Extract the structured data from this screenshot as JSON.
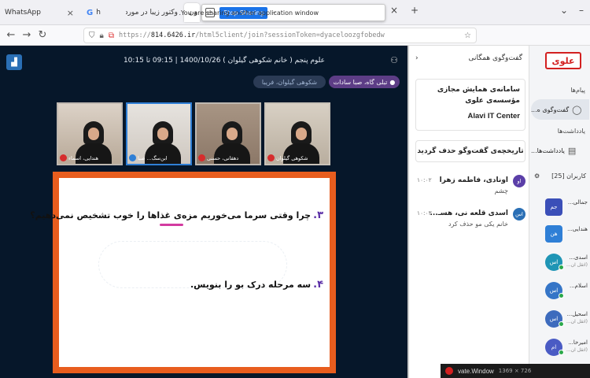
{
  "browser": {
    "tabs": [
      {
        "label": "WhatsApp",
        "active": false
      },
      {
        "label": "h",
        "active": false
      },
      {
        "label": "وکتور زیبا در مورد ایرانگردی",
        "active": false
      },
      {
        "label": "ون",
        "active": true
      }
    ],
    "google_letter": "G",
    "share_bar": {
      "message": "You are sharing another application window.",
      "stop_label": "Stop Sharing",
      "minimize_label": "–"
    },
    "url": {
      "prefix": "https://",
      "host": "814.6426.ir",
      "path": "/html5client/join?sessionToken=dyaceloozgfobedw"
    },
    "new_tab": "+"
  },
  "conference": {
    "title": "علوم پنجم ( خانم شکوهی گیلوان ) 1400/10/26 | 09:15 تا 10:15",
    "talking": "تبلی گاه، صبا سادات",
    "talking2": "شکوهی گیلوان، فریبا",
    "videos": [
      {
        "name": "شکوهی گیلوان",
        "active": false
      },
      {
        "name": "دهقانی، حسنی",
        "active": false
      },
      {
        "name": "ابن‌سگ... صبا",
        "active": true
      },
      {
        "name": "هندایی، اسماء",
        "active": false
      }
    ],
    "slide": {
      "q1_num": "۳.",
      "q1_text": "چرا وقتی سرما می‌خوریم مزه‌ی غذاها را خوب تشخیص نمی‌دهیم؟",
      "q2_num": "۴.",
      "q2_text": "سه مرحله درک بو را بنویس."
    }
  },
  "chat": {
    "header": "گفت‌وگوی همگانی",
    "collapse_icon": "‹",
    "welcome_title": "سامانه‌ی همایش مجازی مؤسسه‌ی علوی",
    "welcome_en": "Alavi IT Center",
    "history_btn": "تاریخچه‌ی گفت‌وگو حذف گردید",
    "messages": [
      {
        "avatar": "او",
        "name": "اونادی، فاطمه زهرا",
        "time": "۱۰:۰۲",
        "text": "چشم",
        "color": "#5b3fa8"
      },
      {
        "avatar": "اس",
        "name": "اسدی قلعه نی، هسـ...",
        "time": "۱۰:۰۳",
        "text": "خانم یکی مو حذف کرد",
        "color": "#2a6fb5"
      }
    ]
  },
  "sidebar": {
    "logo": "علوی",
    "messages_section": "پیام‌ها",
    "public_chat": "گفت‌وگوی ه...",
    "notes_section": "یادداشت‌ها",
    "shared_notes": "یادداشت‌ها...",
    "users_label": "کاربران [25]",
    "users": [
      {
        "avatar": "جم",
        "name": "جمالی...",
        "sub": "",
        "color": "#3b4fb8",
        "round": false
      },
      {
        "avatar": "هن",
        "name": "هندایی...",
        "sub": "",
        "color": "#2f7fd6",
        "round": false
      },
      {
        "avatar": "اس",
        "name": "اسدی...",
        "sub": "(اتقل ان...",
        "color": "#1f95b5",
        "round": true
      },
      {
        "avatar": "اس",
        "name": "اسلام...",
        "sub": "",
        "color": "#3575c7",
        "round": true
      },
      {
        "avatar": "اس",
        "name": "اسحیل...",
        "sub": "(اتقل ان...",
        "color": "#3d6bbd",
        "round": true
      },
      {
        "avatar": "ام",
        "name": "امیرخا...",
        "sub": "(اتقل ان...",
        "color": "#4a5bc4",
        "round": true
      }
    ]
  },
  "taskbar": {
    "title": "vate.Window",
    "resolution": "1369 × 726"
  }
}
